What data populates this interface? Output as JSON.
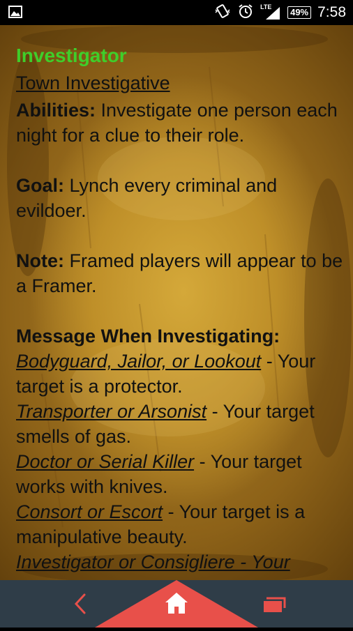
{
  "status_bar": {
    "left_icon": "image-notification-icon",
    "vibrate_icon": "vibrate-icon",
    "alarm_icon": "alarm-clock-icon",
    "network_label": "LTE",
    "battery": "49%",
    "time": "7:58"
  },
  "role": {
    "name": "Investigator",
    "category": "Town Investigative",
    "abilities_label": "Abilities:",
    "abilities_text": " Investigate one person each night for a clue to their role.",
    "goal_label": "Goal:",
    "goal_text": " Lynch every criminal and evildoer.",
    "note_label": "Note:",
    "note_text": " Framed players will appear to be a Framer.",
    "messages_header": "Message When Investigating:",
    "messages": [
      {
        "roles": "Bodyguard, Jailor, or Lookout",
        "text": " - Your target is a protector."
      },
      {
        "roles": "Transporter or Arsonist",
        "text": " - Your target smells of gas."
      },
      {
        "roles": "Doctor or Serial Killer",
        "text": " - Your target works with knives."
      },
      {
        "roles": "Consort or Escort",
        "text": " - Your target is a manipulative beauty."
      }
    ],
    "cut_off_line": "Investigator or Consigliere - Your"
  },
  "nav": {
    "back_icon": "chevron-left-icon",
    "home_icon": "home-icon",
    "recent_icon": "recent-apps-icon",
    "accent": "#e8504a",
    "bar_color": "#2f3d48"
  }
}
